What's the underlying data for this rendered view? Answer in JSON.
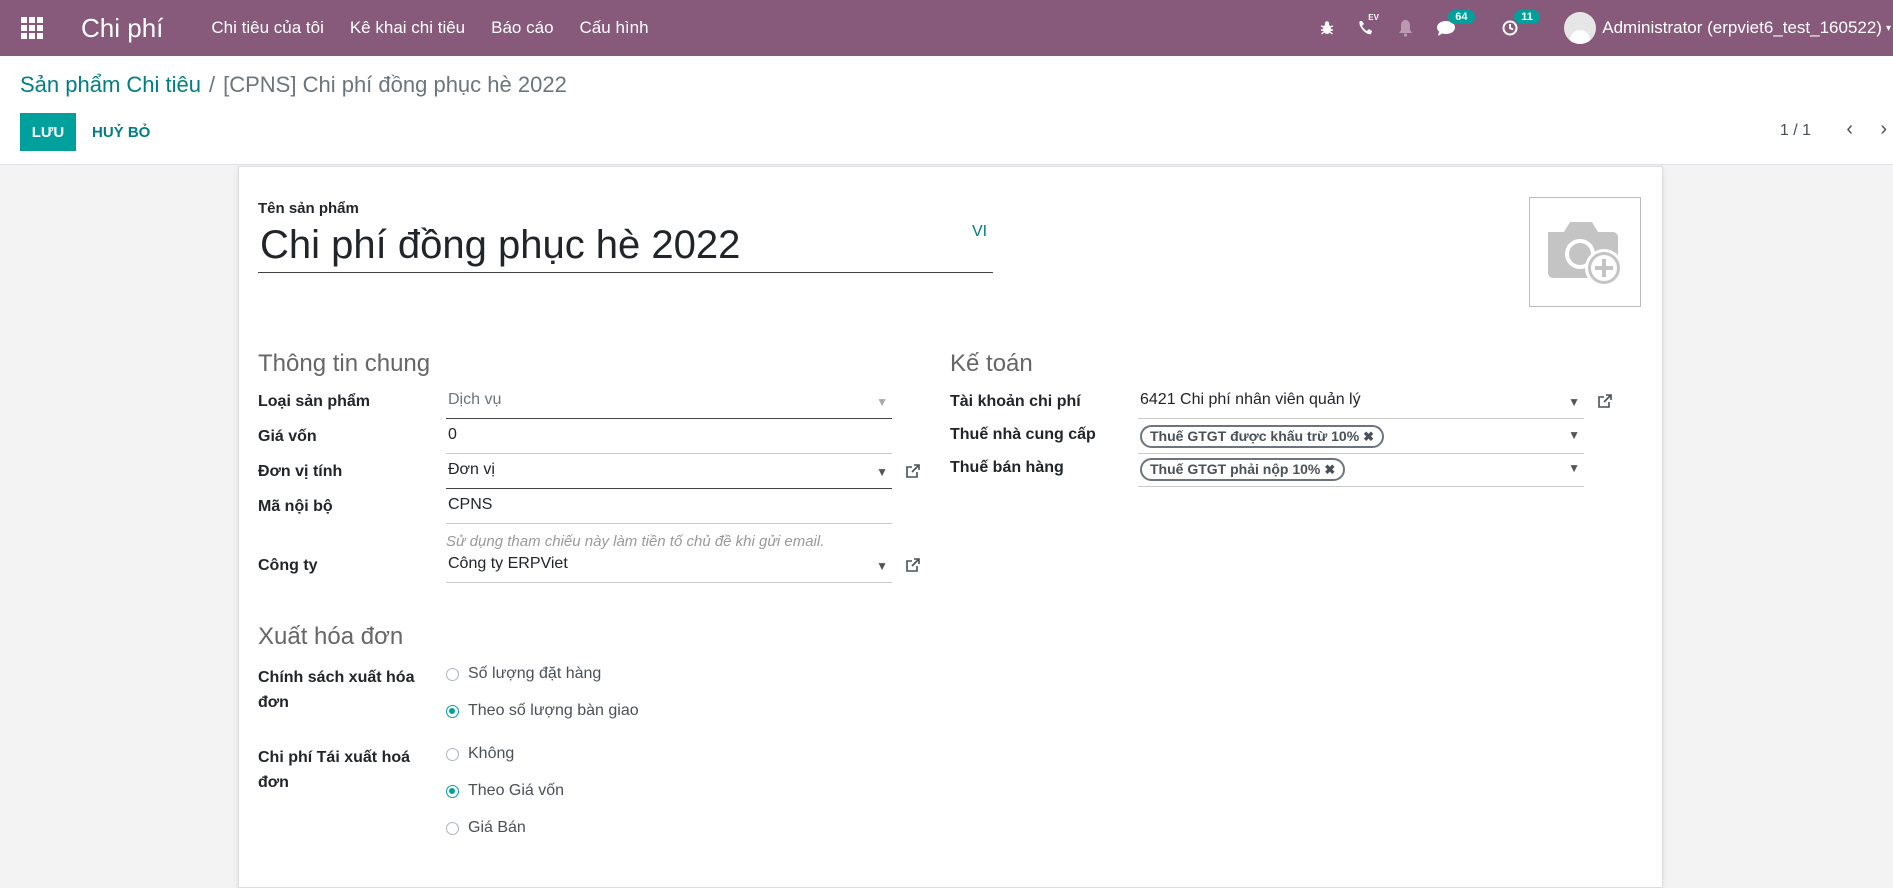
{
  "navbar": {
    "app_title": "Chi phí",
    "menu": [
      "Chi tiêu của tôi",
      "Kê khai chi tiêu",
      "Báo cáo",
      "Cấu hình"
    ],
    "messages_count": "64",
    "activities_count": "11",
    "voip_label": "EV",
    "user": "Administrator (erpviet6_test_160522)",
    "bg_color": "#875a7b"
  },
  "control": {
    "breadcrumb_root": "Sản phẩm Chi tiêu",
    "breadcrumb_sep": "/",
    "breadcrumb_current": "[CPNS] Chi phí đồng phục hè 2022",
    "save_label": "LƯU",
    "discard_label": "HUỶ BỎ",
    "pager": "1 / 1"
  },
  "form": {
    "name_label": "Tên sản phẩm",
    "name_value": "Chi phí đồng phục hè 2022",
    "lang": "VI",
    "general": {
      "title": "Thông tin chung",
      "type_label": "Loại sản phẩm",
      "type_value": "Dịch vụ",
      "cost_label": "Giá vốn",
      "cost_value": "0",
      "uom_label": "Đơn vị tính",
      "uom_value": "Đơn vị",
      "ref_label": "Mã nội bộ",
      "ref_value": "CPNS",
      "ref_hint": "Sử dụng tham chiếu này làm tiền tố chủ đề khi gửi email.",
      "company_label": "Công ty",
      "company_value": "Công ty ERPViet"
    },
    "accounting": {
      "title": "Kế toán",
      "expense_account_label": "Tài khoản chi phí",
      "expense_account_value": "6421 Chi phí nhân viên quản lý",
      "vendor_tax_label": "Thuế nhà cung cấp",
      "vendor_tax_tag": "Thuế GTGT được khấu trừ 10%",
      "sale_tax_label": "Thuế bán hàng",
      "sale_tax_tag": "Thuế GTGT phải nộp 10%"
    },
    "invoicing": {
      "title": "Xuất hóa đơn",
      "policy_label_1": "Chính sách xuất hóa",
      "policy_label_2": "đơn",
      "policy_opt1": "Số lượng đặt hàng",
      "policy_opt2": "Theo số lượng bàn giao",
      "policy_selected": 2,
      "reinvoice_label_1": "Chi phí Tái xuất hoá",
      "reinvoice_label_2": "đơn",
      "reinvoice_opt1": "Không",
      "reinvoice_opt2": "Theo Giá vốn",
      "reinvoice_opt3": "Giá Bán",
      "reinvoice_selected": 2
    }
  },
  "accent_color": "#00a09d",
  "link_color": "#017e84"
}
